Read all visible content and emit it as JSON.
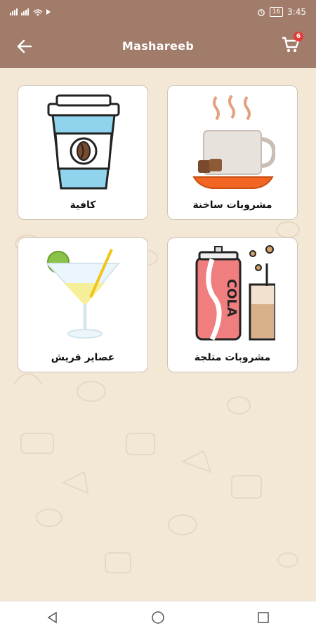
{
  "status_bar": {
    "signal_left": "⚡▐▐ ▐▐",
    "battery": "16",
    "time": "3:45"
  },
  "app_bar": {
    "title": "Mashareeb",
    "cart_count": "6"
  },
  "categories": [
    {
      "label": "كافية"
    },
    {
      "label": "مشروبات ساخنة"
    },
    {
      "label": "عصاير فريش"
    },
    {
      "label": "مشروبات متلجة"
    }
  ],
  "cola_text": "COLA",
  "icons": {
    "back": "arrow-left-icon",
    "cart": "cart-icon",
    "nav_back": "triangle-back-icon",
    "nav_home": "circle-home-icon",
    "nav_recent": "square-recent-icon"
  },
  "colors": {
    "app_bar": "#a27c6a",
    "background": "#f3e7d6",
    "badge": "#e53935"
  }
}
